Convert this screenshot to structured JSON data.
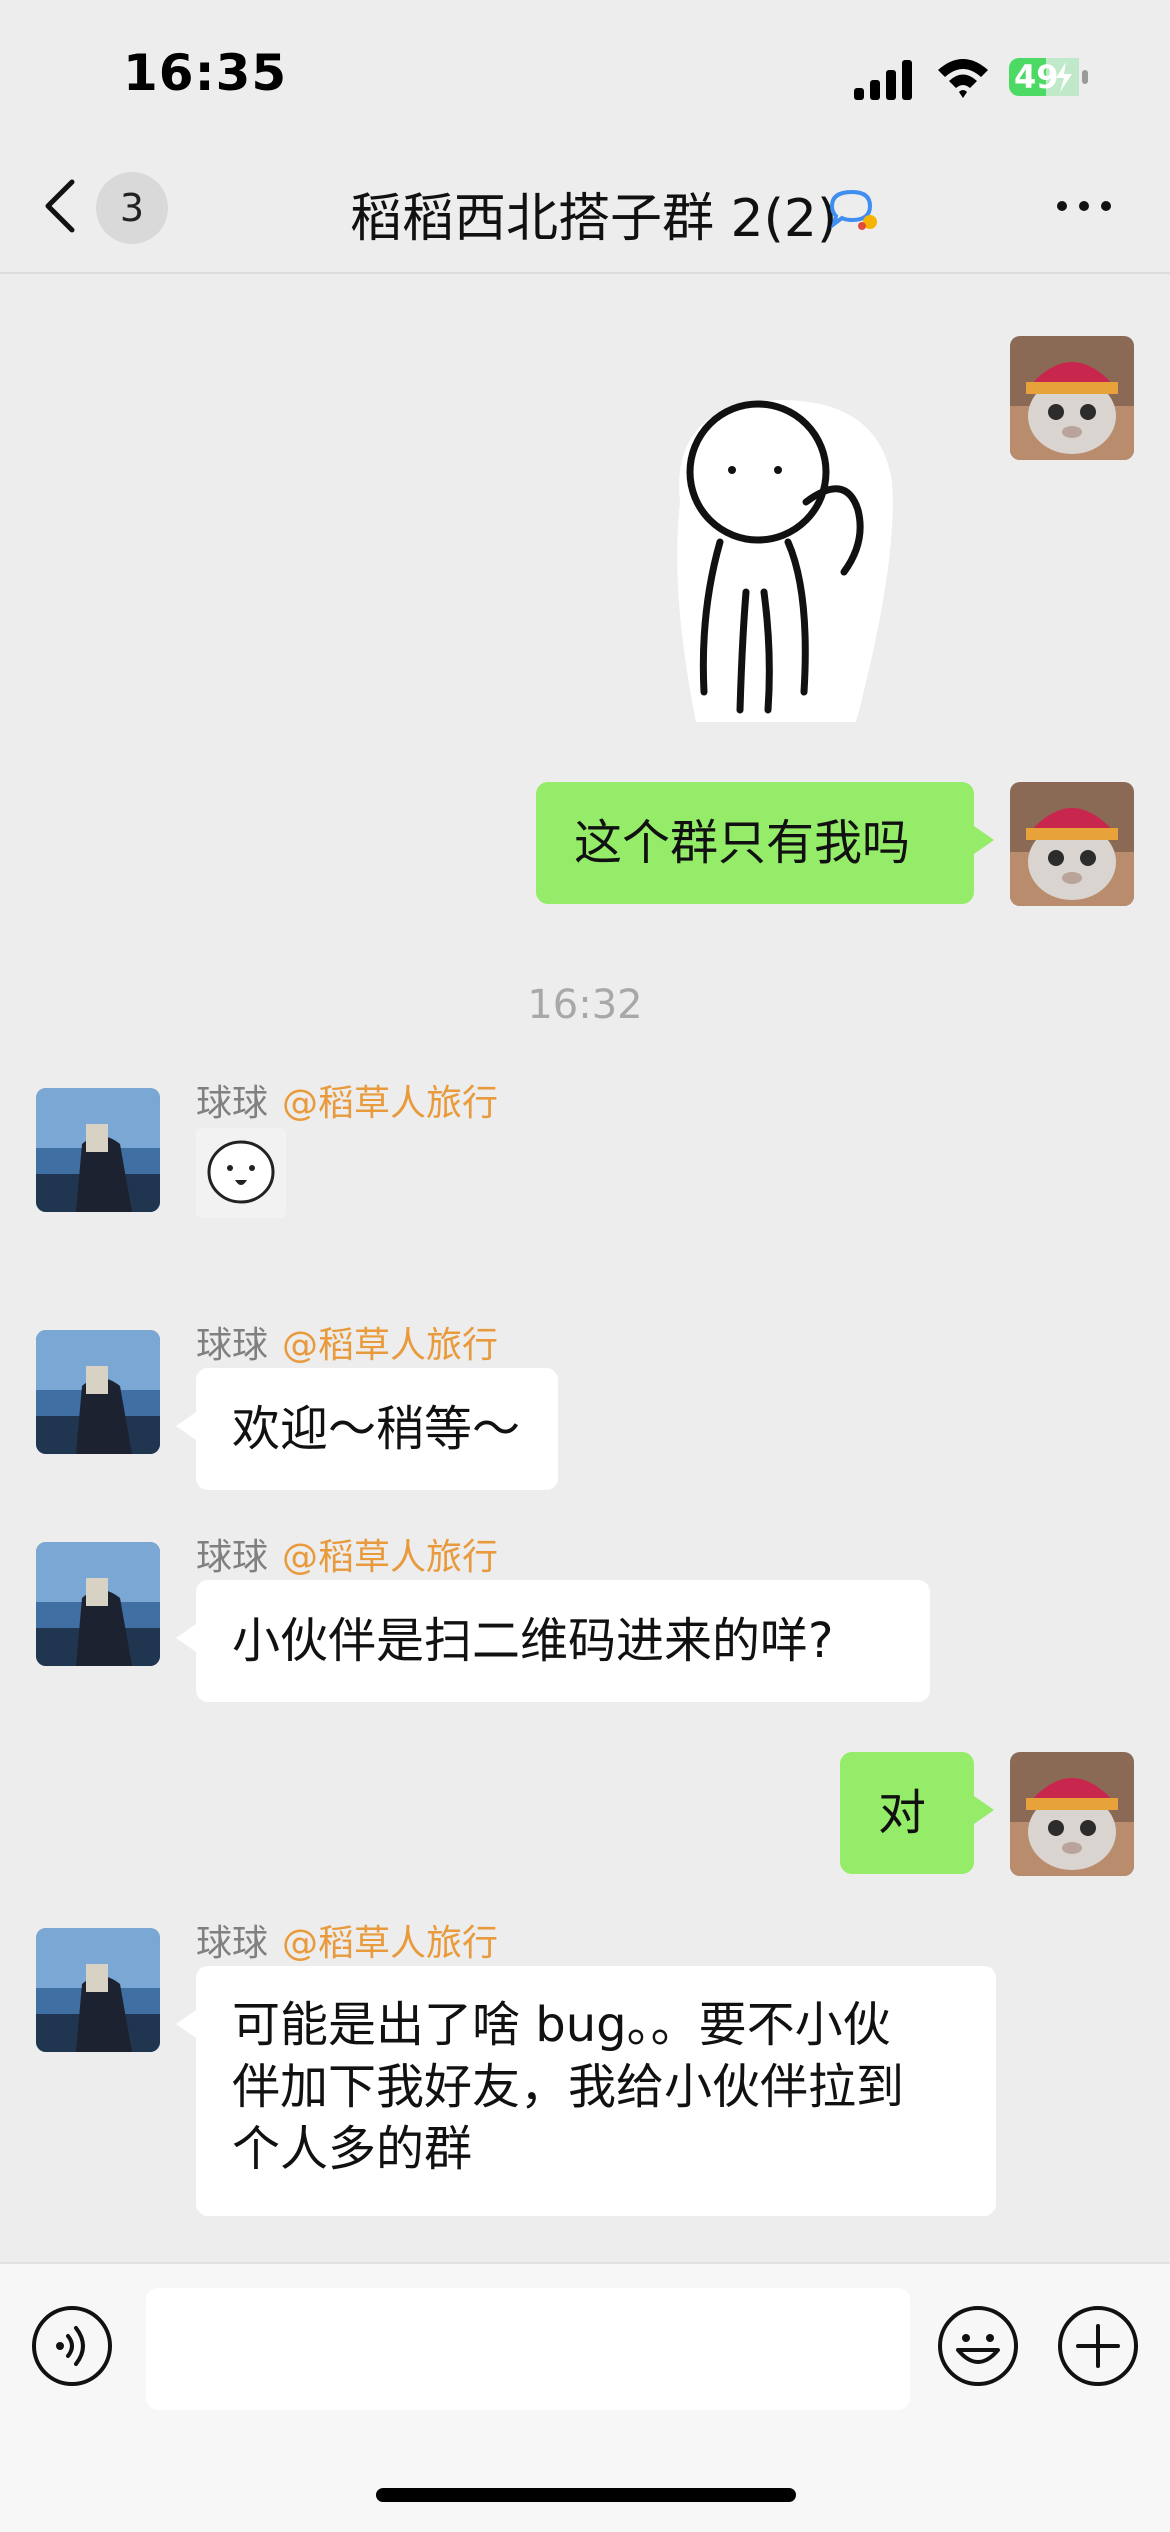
{
  "status_bar": {
    "time": "16:35",
    "battery_percent": "49"
  },
  "nav": {
    "unread_count": "3",
    "title": "稻稻西北搭子群 2(2)"
  },
  "messages": {
    "m2_text": "这个群只有我吗",
    "timestamp": "16:32",
    "sender_name": "球球",
    "mention": "@稻草人旅行",
    "m4_text": "欢迎～稍等～",
    "m5_text": "小伙伴是扫二维码进来的咩?",
    "m6_text": "对",
    "m7_line1": "可能是出了啥 bug。。要不小伙",
    "m7_line2": "伴加下我好友，我给小伙伴拉到",
    "m7_line3": "个人多的群"
  },
  "colors": {
    "background": "#ededed",
    "my_bubble": "#95ec69",
    "their_bubble": "#ffffff",
    "mention": "#e89a3c",
    "battery_green": "#4cd964"
  }
}
